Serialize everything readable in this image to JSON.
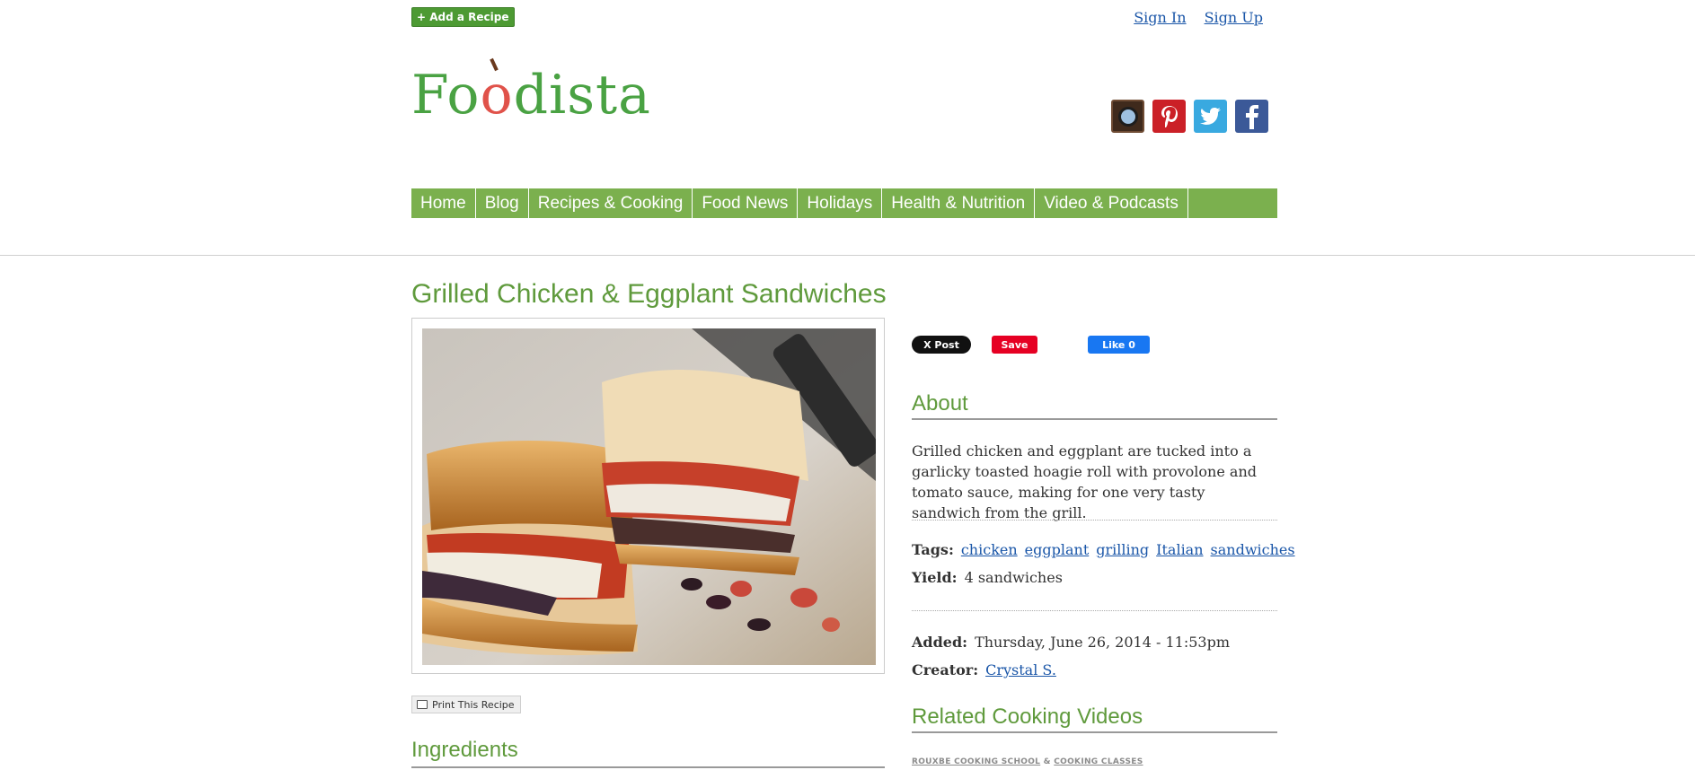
{
  "top": {
    "add_recipe": "+ Add a Recipe",
    "sign_in": "Sign In",
    "sign_up": "Sign Up"
  },
  "logo": {
    "prefix": "Fo",
    "o": "o",
    "suffix": "dista"
  },
  "social": [
    "instagram-icon",
    "pinterest-icon",
    "twitter-icon",
    "facebook-icon"
  ],
  "nav": [
    "Home",
    "Blog",
    "Recipes & Cooking",
    "Food News",
    "Holidays",
    "Health & Nutrition",
    "Video & Podcasts"
  ],
  "recipe": {
    "title": "Grilled Chicken & Eggplant Sandwiches",
    "print_label": "Print This Recipe",
    "ingredients_heading": "Ingredients"
  },
  "share": {
    "post": "X Post",
    "save": "Save",
    "like": "Like 0"
  },
  "about": {
    "heading": "About",
    "text": "Grilled chicken and eggplant are tucked into a garlicky toasted hoagie roll with provolone and tomato sauce, making for one very tasty sandwich from the grill."
  },
  "meta": {
    "tags_label": "Tags:",
    "tags": [
      "chicken",
      "eggplant",
      "grilling",
      "Italian",
      "sandwiches"
    ],
    "yield_label": "Yield:",
    "yield": "4 sandwiches",
    "added_label": "Added:",
    "added": "Thursday, June 26, 2014 - 11:53pm",
    "creator_label": "Creator:",
    "creator": "Crystal S."
  },
  "related": {
    "heading": "Related Cooking Videos",
    "school": "ROUXBE COOKING SCHOOL",
    "amp": "&",
    "classes": "COOKING CLASSES"
  },
  "colors": {
    "brand_green": "#7bb04e",
    "title_green": "#5f9a3c",
    "link_blue": "#1a56a8"
  }
}
